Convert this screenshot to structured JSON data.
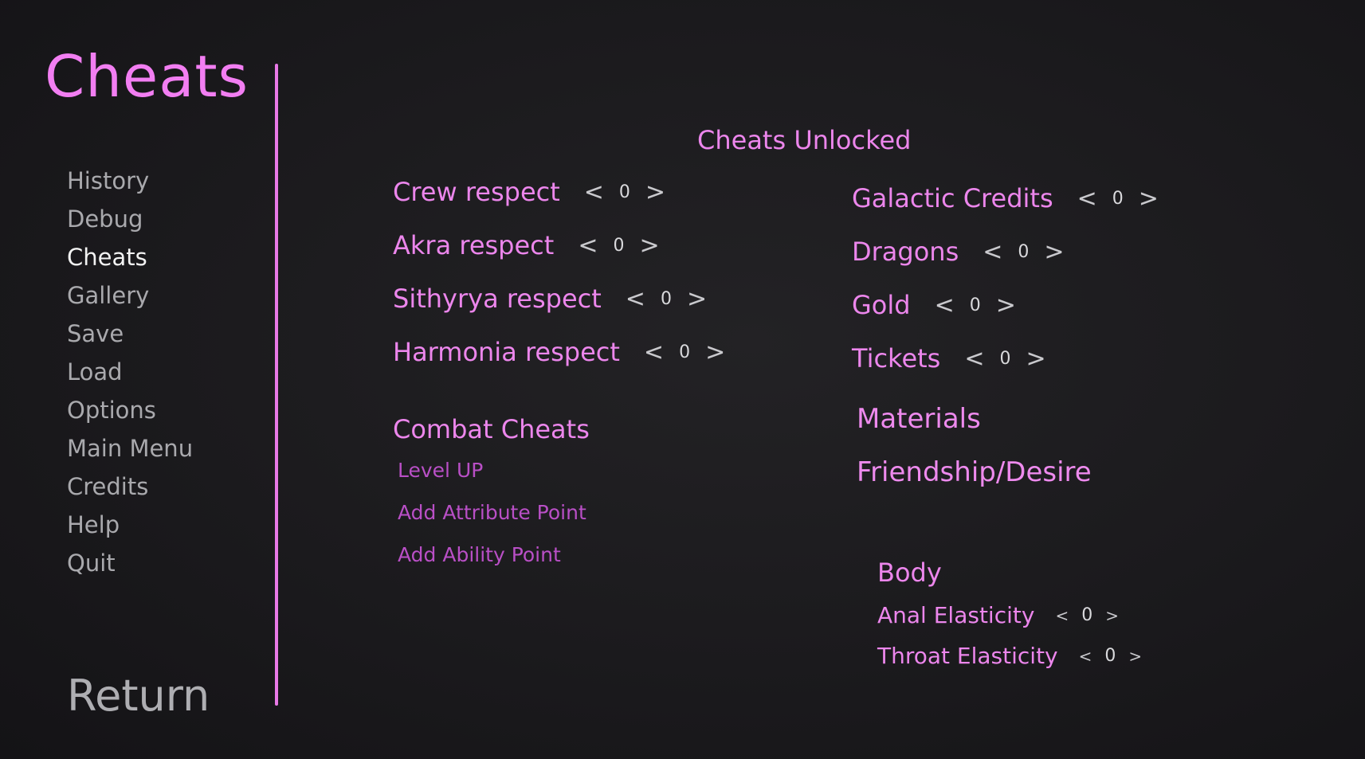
{
  "screen": {
    "title": "Cheats",
    "section_title": "Cheats Unlocked",
    "return_label": "Return"
  },
  "nav": {
    "items": [
      {
        "label": "History",
        "active": false
      },
      {
        "label": "Debug",
        "active": false
      },
      {
        "label": "Cheats",
        "active": true
      },
      {
        "label": "Gallery",
        "active": false
      },
      {
        "label": "Save",
        "active": false
      },
      {
        "label": "Load",
        "active": false
      },
      {
        "label": "Options",
        "active": false
      },
      {
        "label": "Main Menu",
        "active": false
      },
      {
        "label": "Credits",
        "active": false
      },
      {
        "label": "Help",
        "active": false
      },
      {
        "label": "Quit",
        "active": false
      }
    ]
  },
  "respect": [
    {
      "label": "Crew respect",
      "value": "0"
    },
    {
      "label": "Akra respect",
      "value": "0"
    },
    {
      "label": "Sithyrya respect",
      "value": "0"
    },
    {
      "label": "Harmonia respect",
      "value": "0"
    }
  ],
  "resources": [
    {
      "label": "Galactic Credits",
      "value": "0"
    },
    {
      "label": "Dragons",
      "value": "0"
    },
    {
      "label": "Gold",
      "value": "0"
    },
    {
      "label": "Tickets",
      "value": "0"
    }
  ],
  "arrows": {
    "left": "<",
    "right": ">"
  },
  "combat": {
    "title": "Combat Cheats",
    "actions": [
      "Level UP",
      "Add Attribute Point",
      "Add Ability Point"
    ]
  },
  "categories": [
    "Materials",
    "Friendship/Desire"
  ],
  "body": {
    "title": "Body",
    "stats": [
      {
        "label": "Anal Elasticity",
        "value": "0"
      },
      {
        "label": "Throat Elasticity",
        "value": "0"
      }
    ]
  },
  "colors": {
    "accent": "#ec86ec",
    "divider": "#e879e6",
    "action_link": "#b94fc6",
    "nav_text": "#a9a9ad",
    "nav_active": "#f2f2f2",
    "background": "#1b1a1d"
  }
}
